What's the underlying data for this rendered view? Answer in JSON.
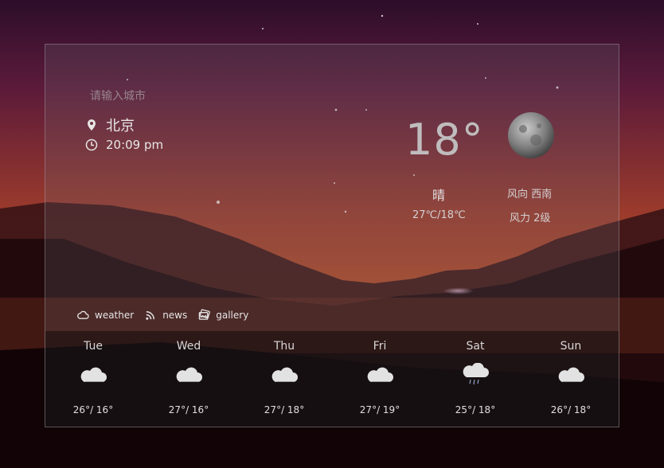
{
  "search": {
    "placeholder": "请输入城市"
  },
  "location": {
    "city": "北京",
    "time": "20:09 pm"
  },
  "current": {
    "temperature": "18°",
    "condition": "晴",
    "range": "27℃/18℃",
    "wind_direction": "风向 西南",
    "wind_power": "风力 2级",
    "icon": "moon-icon"
  },
  "nav": {
    "items": [
      {
        "label": "weather",
        "icon": "cloud-icon"
      },
      {
        "label": "news",
        "icon": "rss-icon"
      },
      {
        "label": "gallery",
        "icon": "gallery-icon"
      }
    ]
  },
  "forecast": [
    {
      "day": "Tue",
      "temps": "26°/ 16°",
      "icon": "cloudy-icon"
    },
    {
      "day": "Wed",
      "temps": "27°/ 16°",
      "icon": "cloudy-icon"
    },
    {
      "day": "Thu",
      "temps": "27°/ 18°",
      "icon": "cloudy-icon"
    },
    {
      "day": "Fri",
      "temps": "27°/ 19°",
      "icon": "cloudy-icon"
    },
    {
      "day": "Sat",
      "temps": "25°/ 18°",
      "icon": "rain-cloud-icon"
    },
    {
      "day": "Sun",
      "temps": "26°/ 18°",
      "icon": "cloudy-icon"
    }
  ],
  "colors": {
    "panel_border": "#b9b9c3",
    "text": "#e8e6e6",
    "sky_top": "#3a1230",
    "sky_glow": "#a8452a"
  }
}
